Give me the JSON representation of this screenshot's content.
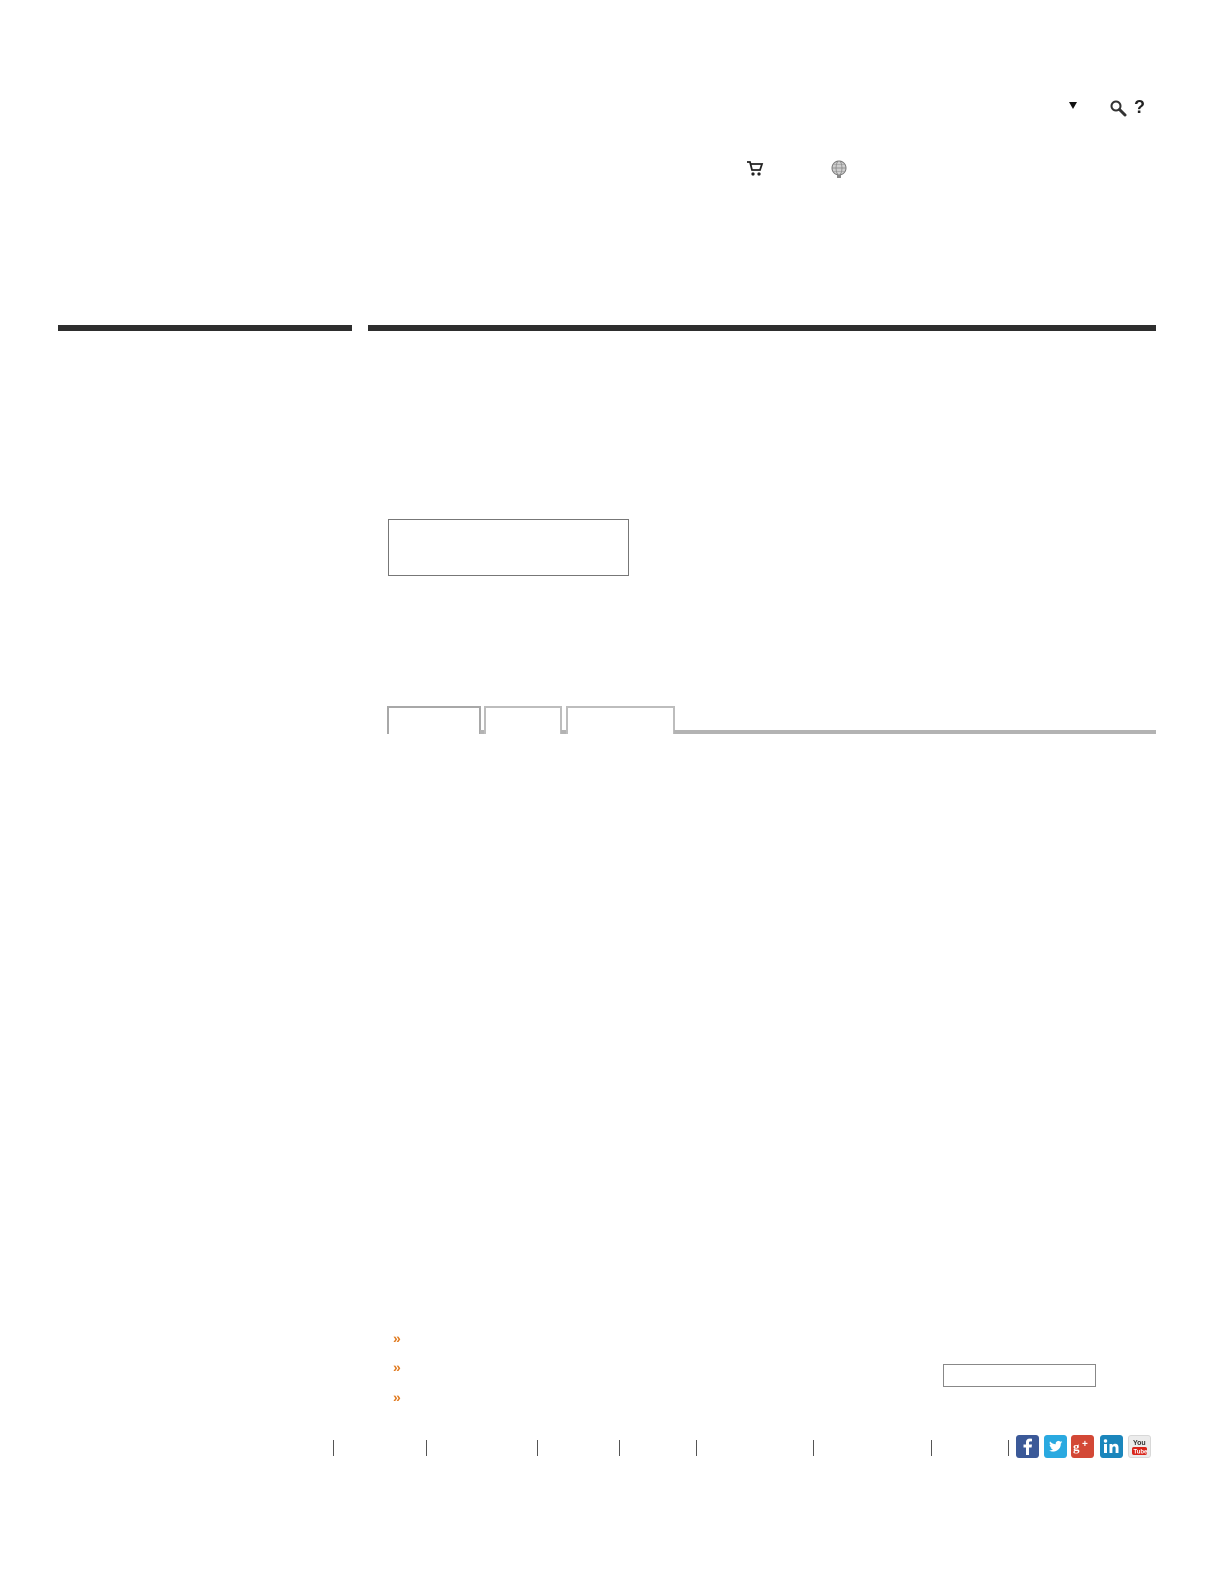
{
  "header": {
    "icons": {
      "dropdown": "triangle-down-icon",
      "search": "search-icon",
      "help": "question-icon",
      "cart": "cart-icon",
      "globe": "globe-icon"
    },
    "help_glyph": "?"
  },
  "main": {
    "tabs": [
      {
        "label": "",
        "active": true
      },
      {
        "label": "",
        "active": false
      },
      {
        "label": "",
        "active": false
      }
    ],
    "input_value": ""
  },
  "links": [
    {
      "label": "",
      "icon": "chevron-double-right-icon"
    },
    {
      "label": "",
      "icon": "chevron-double-right-icon"
    },
    {
      "label": "",
      "icon": "chevron-double-right-icon"
    }
  ],
  "footer": {
    "search_value": "",
    "social": [
      {
        "name": "facebook-icon",
        "color": "#3b5998",
        "glyph": "f"
      },
      {
        "name": "twitter-icon",
        "color": "#2aa9e0",
        "glyph": "t"
      },
      {
        "name": "googleplus-icon",
        "color": "#d34836",
        "glyph": "g+"
      },
      {
        "name": "linkedin-icon",
        "color": "#1b86bc",
        "glyph": "in"
      },
      {
        "name": "youtube-icon",
        "color": "#e6e6e6",
        "glyph": "You"
      }
    ]
  },
  "colors": {
    "accent": "#e07a1f",
    "dark_rule": "#2e2e2e",
    "tab_border": "#bdbdbd"
  }
}
